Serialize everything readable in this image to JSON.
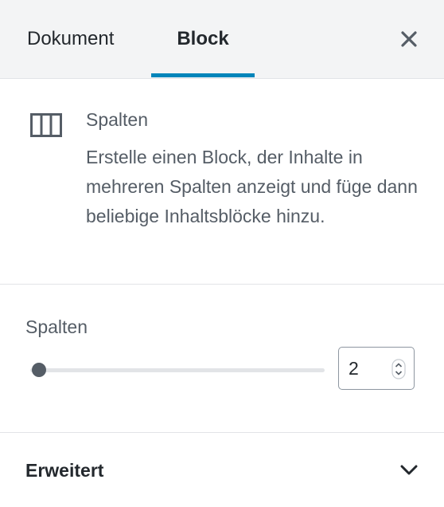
{
  "tabs": [
    {
      "label": "Dokument",
      "active": false
    },
    {
      "label": "Block",
      "active": true
    }
  ],
  "header": {
    "close_icon": "close-icon",
    "accent_color": "#0085ba"
  },
  "block_card": {
    "icon": "columns-icon",
    "title": "Spalten",
    "description": "Erstelle einen Block, der Inhalte in mehreren Spalten anzeigt und füge dann beliebige Inhaltsblöcke hinzu."
  },
  "columns_control": {
    "label": "Spalten",
    "value": "2",
    "slider_position": 0.0
  },
  "advanced_panel": {
    "label": "Erweitert",
    "icon": "chevron-down-icon",
    "expanded": false
  }
}
